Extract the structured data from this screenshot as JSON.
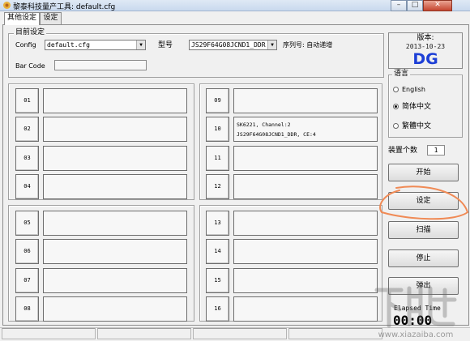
{
  "window": {
    "title": "黎泰科技量产工具: default.cfg",
    "minimize": "–",
    "maximize": "□",
    "close": "✕"
  },
  "tabs": [
    {
      "label": "其他设定",
      "active": true
    },
    {
      "label": "设定",
      "active": false
    }
  ],
  "current_settings": {
    "legend": "目前设定",
    "config_label": "Config",
    "config_value": "default.cfg",
    "model_label": "型号",
    "model_value": "JS29F64G08JCND1_DDR",
    "serial_label": "序列号: 自动递增",
    "barcode_label": "Bar Code",
    "barcode_value": ""
  },
  "slots": [
    {
      "num": "01",
      "info": []
    },
    {
      "num": "02",
      "info": []
    },
    {
      "num": "03",
      "info": []
    },
    {
      "num": "04",
      "info": []
    },
    {
      "num": "05",
      "info": []
    },
    {
      "num": "06",
      "info": []
    },
    {
      "num": "07",
      "info": []
    },
    {
      "num": "08",
      "info": []
    },
    {
      "num": "09",
      "info": []
    },
    {
      "num": "10",
      "info": [
        "SK6221, Channel:2",
        "JS29F64G08JCND1_DDR, CE:4"
      ]
    },
    {
      "num": "11",
      "info": []
    },
    {
      "num": "12",
      "info": []
    },
    {
      "num": "13",
      "info": []
    },
    {
      "num": "14",
      "info": []
    },
    {
      "num": "15",
      "info": []
    },
    {
      "num": "16",
      "info": []
    }
  ],
  "version": {
    "label": "版本:",
    "date": "2013-10-23",
    "code": "DG"
  },
  "language": {
    "legend": "语言",
    "options": [
      {
        "label": "English",
        "selected": false
      },
      {
        "label": "简体中文",
        "selected": true
      },
      {
        "label": "繁體中文",
        "selected": false
      }
    ]
  },
  "device_count": {
    "label": "装置个数",
    "value": "1"
  },
  "buttons": {
    "start": "开始",
    "settings": "设定",
    "scan": "扫描",
    "stop": "停止",
    "eject": "弹出"
  },
  "elapsed": {
    "label": "Elapsed Time",
    "value": "00:00"
  },
  "watermark": {
    "text": "下载吧",
    "url": "www.xiazaiba.com"
  },
  "colors": {
    "version_code": "#1d3fd6",
    "highlight_stroke": "#f08a55"
  }
}
